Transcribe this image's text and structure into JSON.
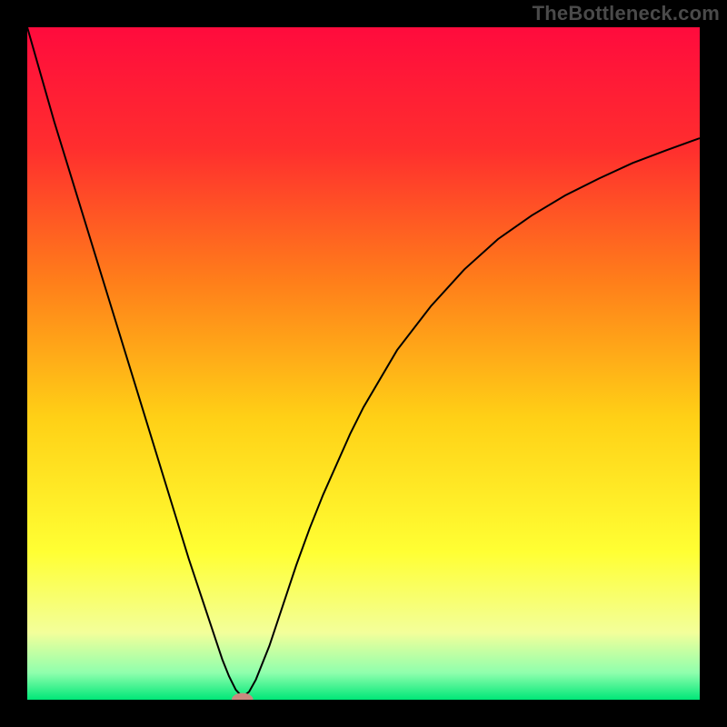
{
  "watermark": "TheBottleneck.com",
  "chart_data": {
    "type": "line",
    "title": "",
    "xlabel": "",
    "ylabel": "",
    "xlim": [
      0,
      100
    ],
    "ylim": [
      0,
      100
    ],
    "grid": false,
    "legend": false,
    "background_gradient_stops": [
      {
        "offset": 0.0,
        "color": "#ff0b3d"
      },
      {
        "offset": 0.18,
        "color": "#ff2e2e"
      },
      {
        "offset": 0.38,
        "color": "#ff7f1a"
      },
      {
        "offset": 0.58,
        "color": "#ffd016"
      },
      {
        "offset": 0.78,
        "color": "#ffff33"
      },
      {
        "offset": 0.9,
        "color": "#f3ff9a"
      },
      {
        "offset": 0.96,
        "color": "#8fffad"
      },
      {
        "offset": 1.0,
        "color": "#00e778"
      }
    ],
    "series": [
      {
        "name": "bottleneck-curve",
        "color": "#000000",
        "x": [
          0,
          2,
          4,
          6,
          8,
          10,
          12,
          14,
          16,
          18,
          20,
          22,
          24,
          26,
          28,
          29,
          30,
          31,
          32,
          33,
          34,
          36,
          38,
          40,
          42,
          44,
          46,
          48,
          50,
          55,
          60,
          65,
          70,
          75,
          80,
          85,
          90,
          95,
          100
        ],
        "y": [
          100,
          93,
          86,
          79.5,
          73,
          66.5,
          60,
          53.5,
          47,
          40.5,
          34,
          27.5,
          21,
          15,
          9,
          6,
          3.5,
          1.5,
          0.4,
          1.2,
          3,
          8,
          14,
          20,
          25.5,
          30.5,
          35,
          39.5,
          43.5,
          52,
          58.5,
          64,
          68.5,
          72,
          75,
          77.5,
          79.8,
          81.7,
          83.5
        ]
      }
    ],
    "marker": {
      "name": "optimal-point",
      "x": 32,
      "y": 0,
      "rx": 1.6,
      "ry": 1.0,
      "fill": "#c98a7f"
    }
  }
}
